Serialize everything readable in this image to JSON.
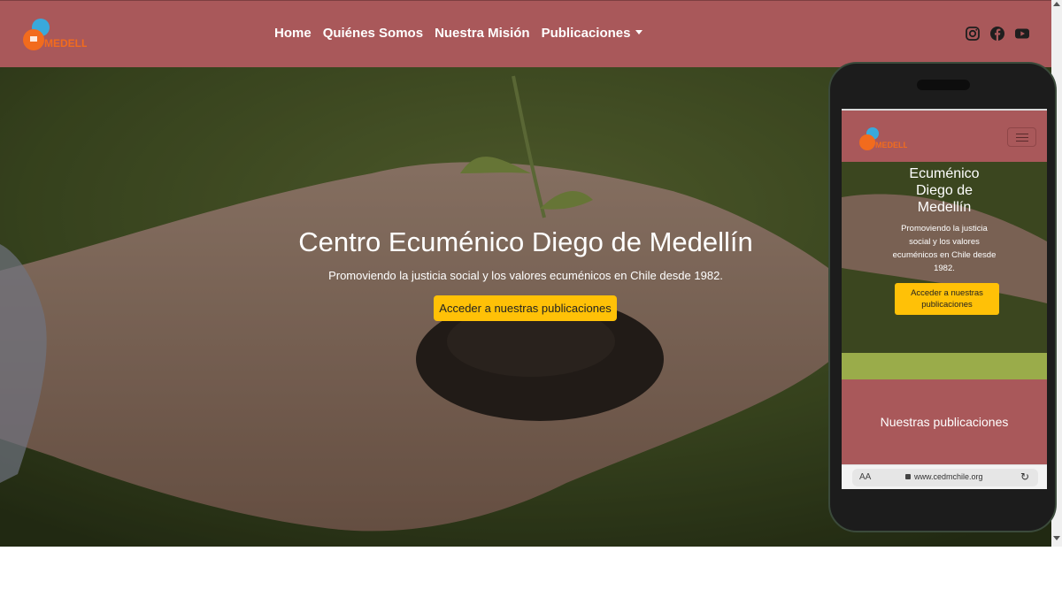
{
  "site": {
    "logo_text": "MEDELLÍN",
    "colors": {
      "navbar": "#a9585a",
      "button": "#ffc107",
      "band": "#9aac4a"
    }
  },
  "nav": {
    "items": [
      "Home",
      "Quiénes Somos",
      "Nuestra Misión",
      "Publicaciones"
    ],
    "social": [
      "instagram-icon",
      "facebook-icon",
      "youtube-icon"
    ]
  },
  "hero": {
    "title": "Centro Ecuménico Diego de Medellín",
    "subtitle": "Promoviendo la justicia social y los valores ecuménicos en Chile desde 1982.",
    "button": "Acceder a nuestras publicaciones"
  },
  "phone": {
    "title": "Ecuménico Diego de Medellín",
    "subtitle": "Promoviendo la justicia social y los valores ecuménicos en Chile desde 1982.",
    "button": "Acceder a nuestras publicaciones",
    "section_title": "Nuestras publicaciones",
    "url_aa": "AA",
    "url": "www.cedmchile.org"
  }
}
